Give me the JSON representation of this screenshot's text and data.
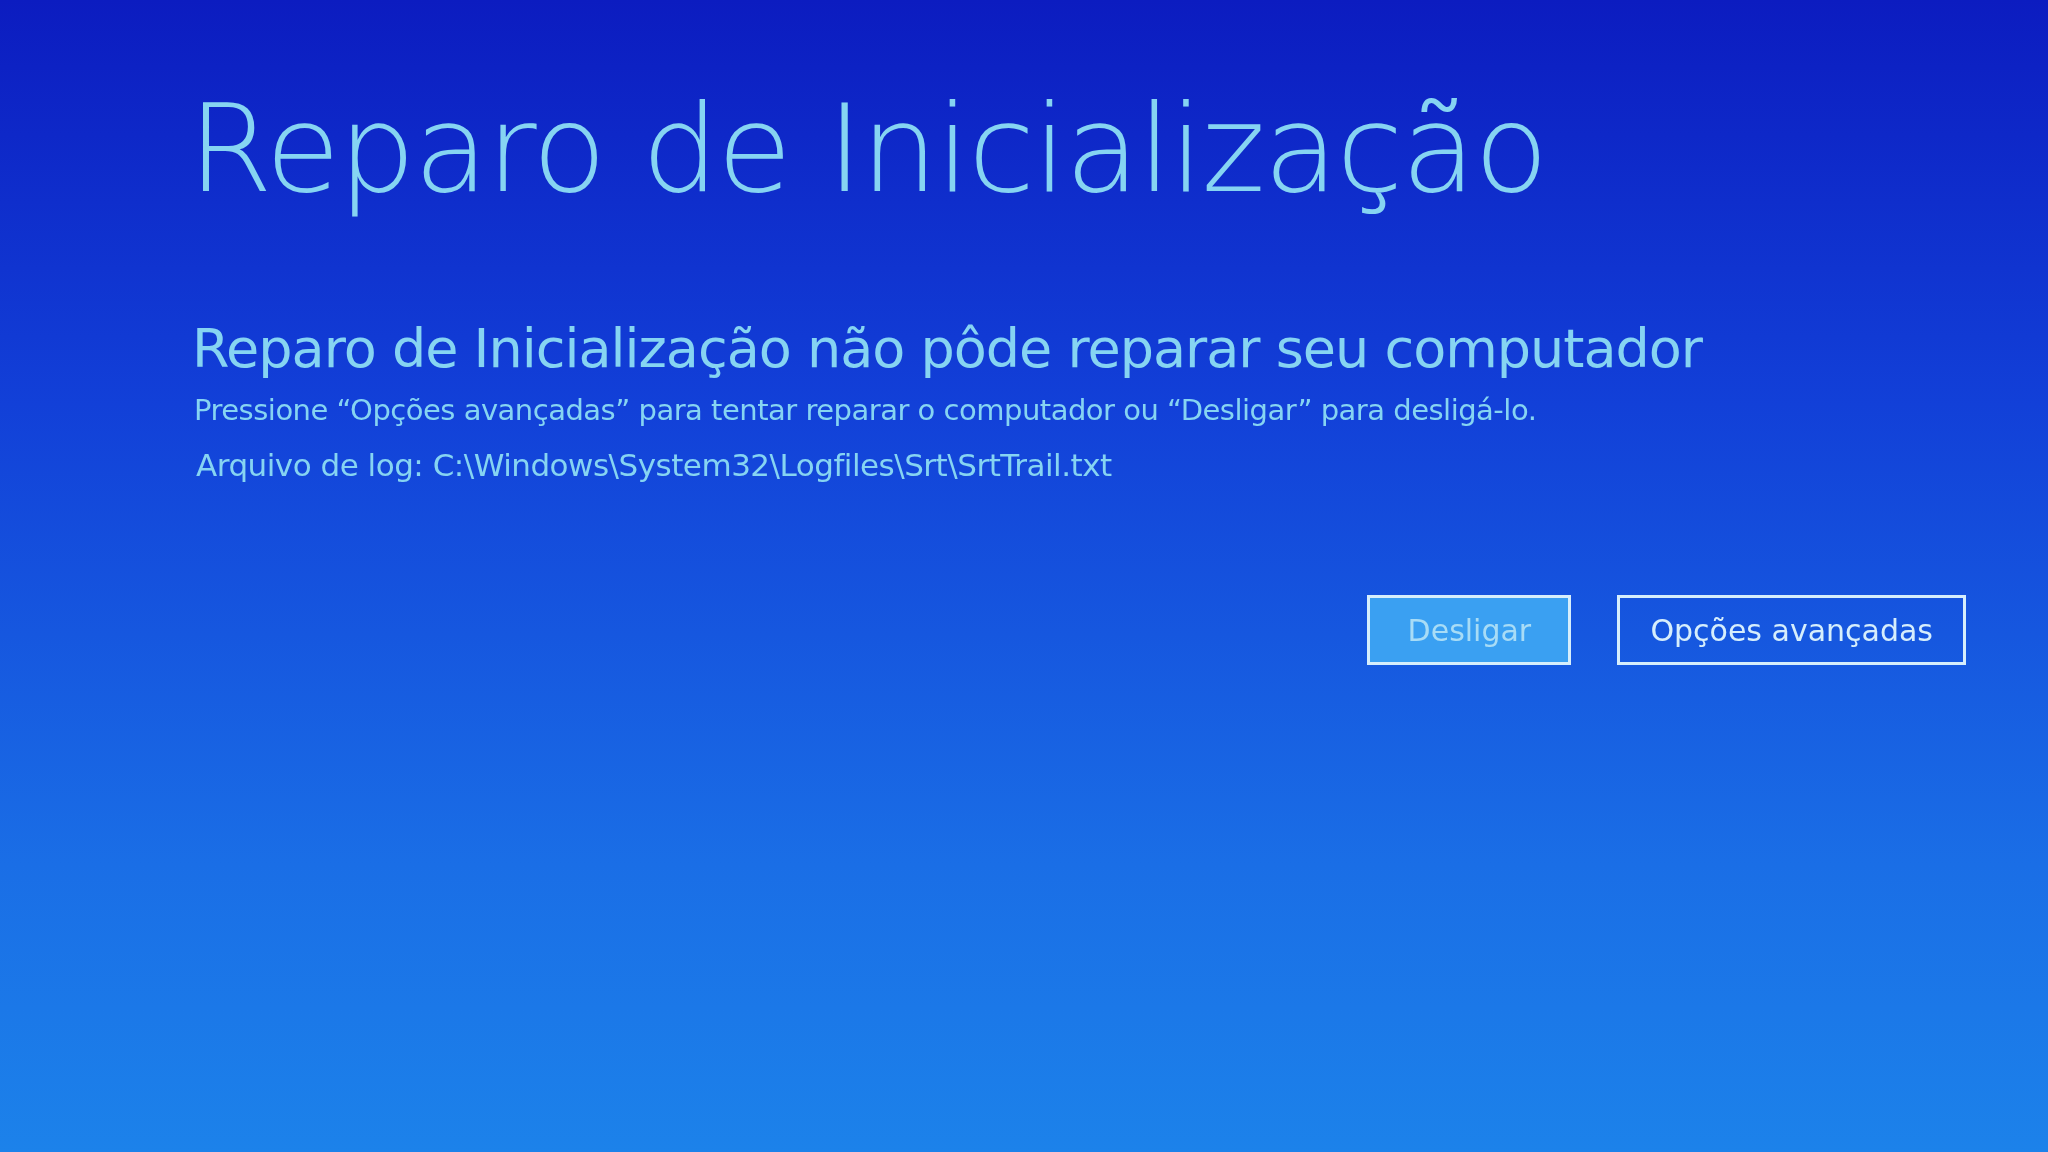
{
  "title": "Reparo de Inicialização",
  "heading": "Reparo de Inicialização não pôde reparar seu computador",
  "message": "Pressione “Opções avançadas” para tentar reparar o computador ou “Desligar” para desligá-lo.",
  "log_file": "Arquivo de log: C:\\Windows\\System32\\Logfiles\\Srt\\SrtTrail.txt",
  "buttons": [
    {
      "label": "Desligar",
      "focused": true
    },
    {
      "label": "Opções avançadas",
      "focused": false
    }
  ]
}
